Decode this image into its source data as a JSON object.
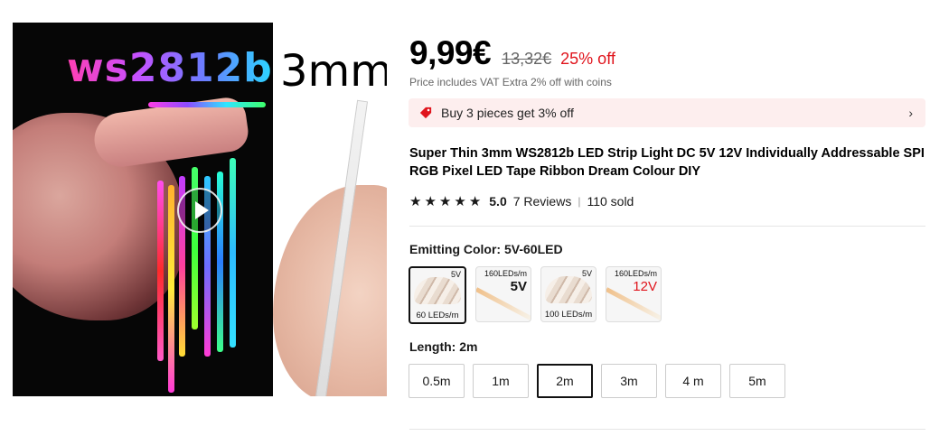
{
  "media": {
    "brand_text": "ws2812b",
    "size_text": "3mm",
    "play_icon": "play-icon"
  },
  "price": {
    "current": "9,99€",
    "original": "13,32€",
    "discount": "25% off",
    "vat_note": "Price includes VAT Extra 2% off with coins"
  },
  "promo": {
    "text": "Buy 3 pieces get 3% off",
    "icon": "tag-icon",
    "chevron": "›"
  },
  "product": {
    "title": "Super Thin 3mm WS2812b LED Strip Light DC 5V 12V Individually Addressable SPI RGB Pixel LED Tape Ribbon Dream Colour DIY"
  },
  "rating": {
    "value": "5.0",
    "reviews": "7 Reviews",
    "separator": "|",
    "sold": "110 sold",
    "stars": 5
  },
  "color": {
    "label": "Emitting Color: 5V-60LED",
    "options": [
      {
        "top": "5V",
        "big": "",
        "bottom": "60 LEDs/m",
        "selected": true
      },
      {
        "top": "160LEDs/m",
        "big": "5V",
        "bottom": "",
        "selected": false
      },
      {
        "top": "5V",
        "big": "",
        "bottom": "100 LEDs/m",
        "selected": false
      },
      {
        "top": "160LEDs/m",
        "big": "12V",
        "bottom": "",
        "selected": false
      }
    ]
  },
  "length": {
    "label": "Length: 2m",
    "options": [
      "0.5m",
      "1m",
      "2m",
      "3m",
      "4 m",
      "5m"
    ],
    "selected_index": 2
  },
  "colors": {
    "discount_red": "#e0141c",
    "promo_bg": "#fdeeee"
  }
}
